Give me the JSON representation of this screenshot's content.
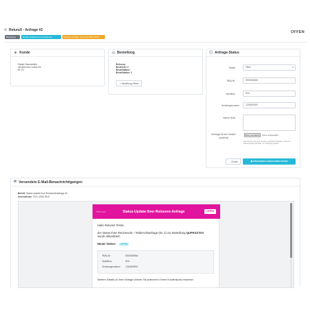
{
  "header": {
    "title": "ReturaX - Anfrage #2",
    "status": "OFFEN",
    "badges": [
      {
        "label": "Bestellung",
        "color": "#6c757d"
      },
      {
        "label": "kunde-info@returax-contacts.de",
        "color": "#25b9d7"
      },
      {
        "label": "Kunden-Anfrage: ab 23.12.2024 12:44",
        "color": "#f0a92b"
      }
    ]
  },
  "customer": {
    "heading": "Kunde",
    "name": "Patrick Sommerfeld",
    "email": "info@returax-contact.de",
    "id": "ID: 10"
  },
  "order": {
    "heading": "Bestellung",
    "lines": [
      "Referenz:",
      "Bestell-ID: 2",
      "Bestelldatum:",
      "Bestellstatus: 1"
    ],
    "view_button": "Bestellung öffnen"
  },
  "request_status": {
    "heading": "Anfrage-Status",
    "labels": {
      "status": "Status",
      "rma": "RMA-Nr.",
      "carrier": "Spediteur",
      "tracking": "Sendungsnummer",
      "internal_note": "Interne Notiz",
      "attachments": "Anhänge für den Kunden (optional)"
    },
    "status_value": "Offen",
    "rma_value": "SS53454561",
    "carrier_value": "DHL",
    "tracking_value": "1234567890",
    "file_button": "Datei auswählen",
    "file_none": "Keine ausgewählt",
    "help_text": "Hier können Sie dem Kunden zusätzliche Dateien, etwa ein Retourenlabel als PDF, zur Verfügung stellen.",
    "back_button": "Zurück",
    "save_button": "SPEICHERN & BENACHRICHTIGEN"
  },
  "notifications": {
    "heading": "Versendete E-Mail-Benachrichtigungen",
    "subject_label": "Betreff:",
    "subject_value": "Status-Update Ihrer Rücksendeanfrage #2",
    "sent_label": "Gesendet am:",
    "sent_value": "23.01.2025 09:47"
  },
  "email": {
    "title": "Status-Update Ihrer Retouren-Anfrage",
    "badge": "OFFEN",
    "logo": "ReturaX",
    "greeting": "Hallo ReturaX Tester,",
    "body_line1": "der Status Ihrer Rücksende- / Widerrufsanfrage (Nr. 2) zur Bestellung",
    "order_ref": "QUPKXZTAX",
    "body_line2": "wurde aktualisiert.",
    "new_status_label": "Neuer Status:",
    "new_status_value": "OFFEN",
    "rows": [
      {
        "label": "RMA-Nr.:",
        "value": "SS53454561"
      },
      {
        "label": "Spediteur:",
        "value": "DHL"
      },
      {
        "label": "Sendungsnummer:",
        "value": "1234567890"
      }
    ],
    "footer": "Weitere Details zu Ihrer Anfrage können Sie jederzeit in Ihrem Kundenkonto einsehen."
  },
  "colors": {
    "accent": "#25b9d7",
    "email_header": "#e2139d",
    "status_badge": "#25b9d7"
  }
}
